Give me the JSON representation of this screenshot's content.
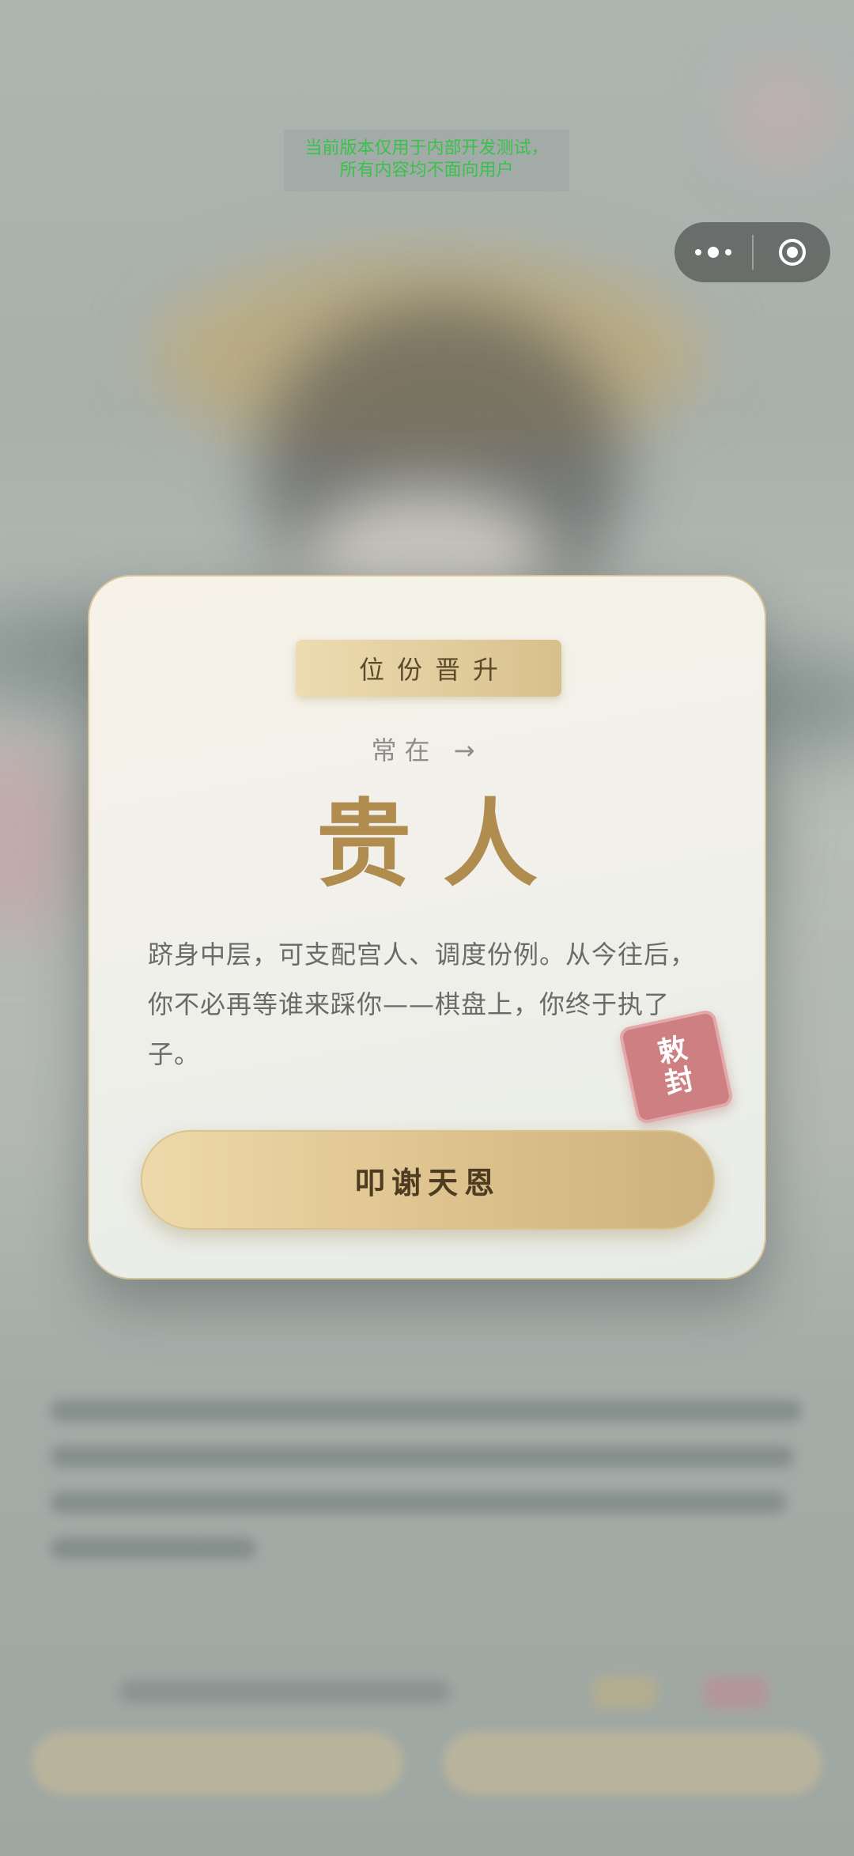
{
  "dev_notice": {
    "line1": "当前版本仅用于内部开发测试，",
    "line2": "所有内容均不面向用户"
  },
  "capsule": {
    "more_icon": "more-dots-icon",
    "close_icon": "close-target-icon"
  },
  "modal": {
    "badge": "位份晋升",
    "previous_rank": "常在 →",
    "new_rank": "贵人",
    "description": "跻身中层，可支配宫人、调度份例。从今往后，你不必再等谁来踩你——棋盘上，你终于执了子。",
    "seal": {
      "char1": "敕",
      "char2": "封"
    },
    "button_label": "叩谢天恩"
  },
  "colors": {
    "gold_accent": "#b08c4e",
    "seal_red": "#cd7f82",
    "button_gold": "#dcc08b",
    "dev_notice_green": "#39c24a"
  }
}
